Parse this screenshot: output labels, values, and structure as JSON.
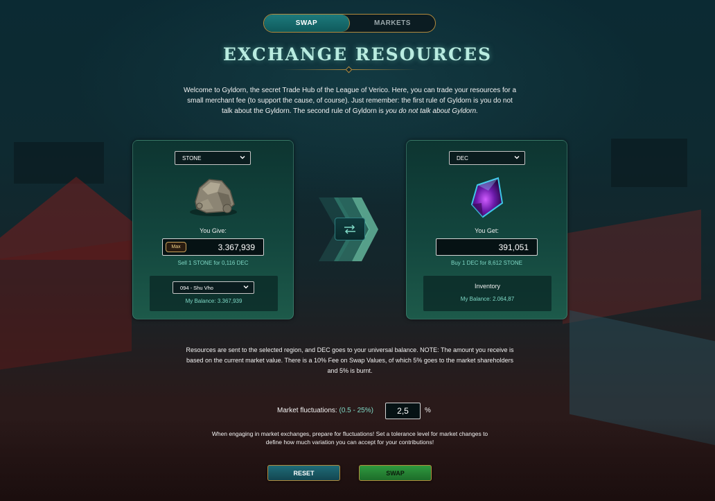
{
  "nav": {
    "tabs": [
      {
        "label": "SWAP",
        "active": true
      },
      {
        "label": "MARKETS",
        "active": false
      }
    ]
  },
  "header": {
    "title": "EXCHANGE RESOURCES",
    "intro_text": "Welcome to Gyldorn, the secret Trade Hub of the League of Verico. Here, you can trade your resources for a small merchant fee (to support the cause, of course). Just remember: the first rule of Gyldorn is you do not talk about the Gyldorn. The second rule of Gyldorn is",
    "intro_emphasis": "you do not talk about Gyldorn."
  },
  "give_panel": {
    "resource_select": "STONE",
    "label": "You Give:",
    "max_label": "Max",
    "amount": "3.367,939",
    "rate": "Sell 1 STONE for 0,116 DEC",
    "region_select": "094 - Shu Vho",
    "balance": "My Balance: 3.367,939"
  },
  "get_panel": {
    "resource_select": "DEC",
    "label": "You Get:",
    "amount": "391,051",
    "rate": "Buy 1 DEC for 8,612 STONE",
    "inventory_label": "Inventory",
    "balance": "My Balance: 2.064,87"
  },
  "info": {
    "note": "Resources are sent to the selected region, and DEC goes to your universal balance. NOTE: The amount you receive is based on the current market value. There is a 10% Fee on Swap Values, of which 5% goes to the market shareholders and 5% is burnt.",
    "fluctuation_label": "Market fluctuations:",
    "fluctuation_range": "(0.5 - 25%)",
    "fluctuation_value": "2,5",
    "percent_sign": "%",
    "warning": "When engaging in market exchanges, prepare for fluctuations! Set a tolerance level for market changes to define how much variation you can accept for your contributions!"
  },
  "actions": {
    "reset_label": "RESET",
    "swap_label": "SWAP"
  },
  "icons": {
    "stone": "stone-resource-icon",
    "dec": "dec-crystal-icon",
    "swap_direction": "swap-arrows-icon",
    "chevron": "chevron-down-icon"
  },
  "colors": {
    "accent_teal": "#7fd9c6",
    "gold_border": "#b48b3d",
    "swap_green": "#2f9a3e",
    "reset_teal": "#1f6c78"
  }
}
